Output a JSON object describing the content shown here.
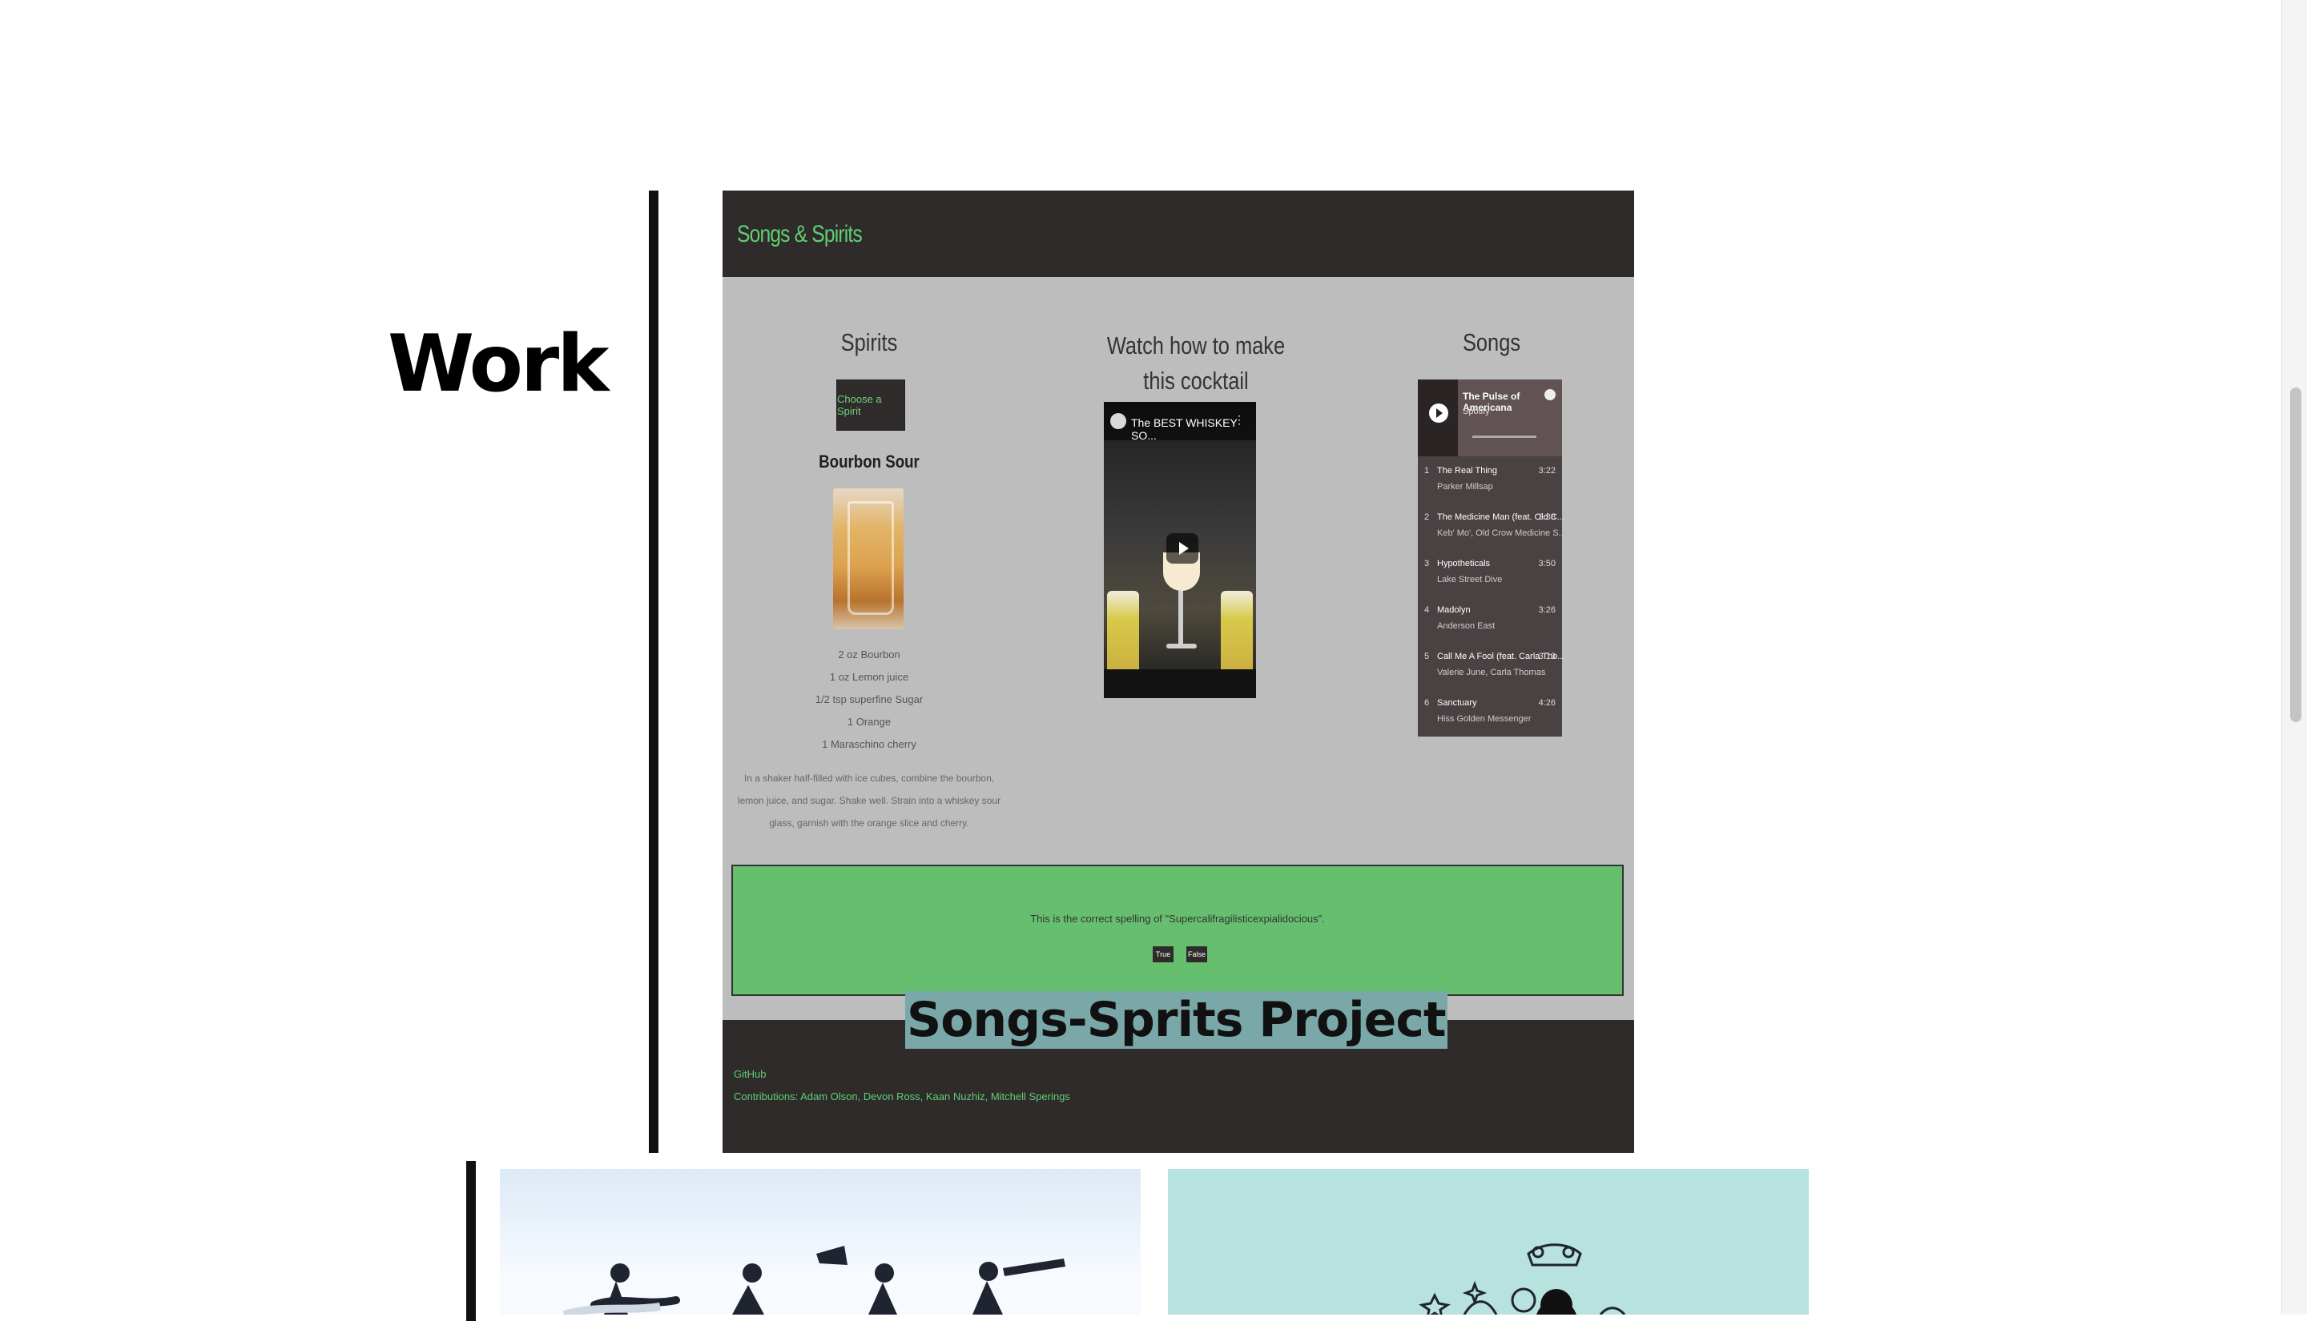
{
  "section": {
    "title": "Work"
  },
  "featured_project": {
    "label": "Songs-Sprits Project",
    "brand": "Songs & Spirits",
    "spirits": {
      "title": "Spirits",
      "choose_button": "Choose a Spirit",
      "drink_name": "Bourbon Sour",
      "ingredients": [
        "2 oz Bourbon",
        "1 oz Lemon juice",
        "1/2 tsp superfine Sugar",
        "1 Orange",
        "1 Maraschino cherry"
      ],
      "instructions": "In a shaker half-filled with ice cubes, combine the bourbon, lemon juice, and sugar. Shake well. Strain into a whiskey sour glass, garnish with the orange slice and cherry."
    },
    "watch": {
      "title": "Watch how to make this cocktail",
      "video_title": "The BEST WHISKEY SO..."
    },
    "songs": {
      "title": "Songs",
      "playlist": "The Pulse of Americana",
      "source": "Spotify",
      "tracks": [
        {
          "num": "1",
          "name": "The Real Thing",
          "artist": "Parker Millsap",
          "duration": "3:22"
        },
        {
          "num": "2",
          "name": "The Medicine Man (feat. Old C...",
          "artist": "Keb' Mo', Old Crow Medicine S...",
          "duration": "3:38"
        },
        {
          "num": "3",
          "name": "Hypotheticals",
          "artist": "Lake Street Dive",
          "duration": "3:50"
        },
        {
          "num": "4",
          "name": "Madolyn",
          "artist": "Anderson East",
          "duration": "3:26"
        },
        {
          "num": "5",
          "name": "Call Me A Fool (feat. Carla Tho...",
          "artist": "Valerie June, Carla Thomas",
          "duration": "3:13"
        },
        {
          "num": "6",
          "name": "Sanctuary",
          "artist": "Hiss Golden Messenger",
          "duration": "4:26"
        }
      ]
    },
    "quiz": {
      "question": "This is the correct spelling of \"Supercalifragilisticexpialidocious\".",
      "true_label": "True",
      "false_label": "False"
    },
    "footer": {
      "link": "GitHub",
      "credits": "Contributions: Adam Olson, Devon Ross, Kaan Nuzhiz, Mitchell Sperings"
    }
  },
  "colors": {
    "accent_green": "#5fcf72",
    "quiz_green": "#66bf6f",
    "dark": "#2f2b2a",
    "label_highlight": "#7aa8a8"
  },
  "icons": [
    "play-icon",
    "spotify-logo-icon",
    "menu-dots-icon"
  ]
}
